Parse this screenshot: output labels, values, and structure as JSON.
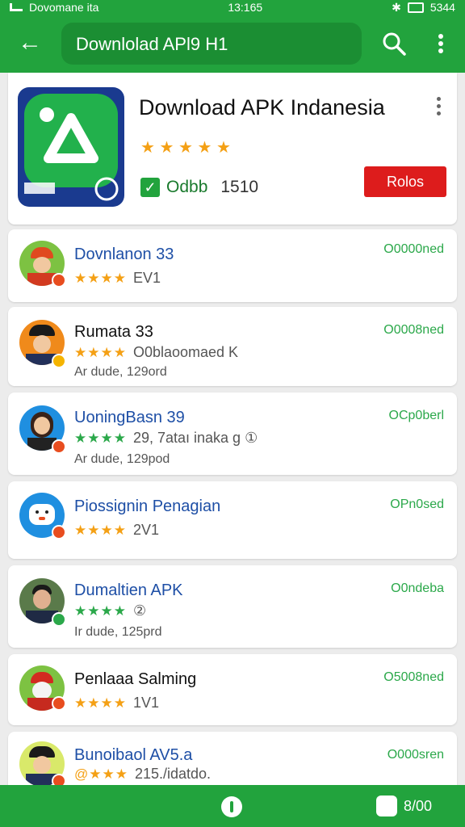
{
  "status_bar": {
    "left": "Dovomane ita",
    "time": "13:165",
    "right": "5344"
  },
  "search": {
    "value": "Downlolad APl9 H1"
  },
  "header": {
    "title": "Download APK  Indanesia",
    "rating_text": "★ ★ ★ ★ ★",
    "verified_text": "Odbb",
    "count_text": "1510",
    "action_label": "Rolos"
  },
  "items": [
    {
      "name": "Dovnlanon 33",
      "stars": "★★★★",
      "count": "EV1",
      "subtitle": "",
      "status": "O0000ned",
      "name_color": "#1e4fa6",
      "star_color": "#f4a015"
    },
    {
      "name": "Rumata 33",
      "stars": "★★★★",
      "count": "O0blaoomaed K",
      "subtitle": "Ar dude, 129ord",
      "status": "O0008ned",
      "name_color": "#111111",
      "star_color": "#f4a015"
    },
    {
      "name": "UoningBasn 39",
      "stars": "★★★★",
      "count": "29, 7ataı inaka g ①",
      "subtitle": "Ar dude, 129pod",
      "status": "OCp0berl",
      "name_color": "#1e4fa6",
      "star_color": "#2ba84a"
    },
    {
      "name": "Piossignin Penagian",
      "stars": "★★★★",
      "count": "2V1",
      "subtitle": "",
      "status": "OPn0sed",
      "name_color": "#1e4fa6",
      "star_color": "#f4a015"
    },
    {
      "name": "Dumaltien APK",
      "stars": "★★★★",
      "count": "②",
      "subtitle": "Ir dude, 125prd",
      "status": "O0ndeba",
      "name_color": "#1e4fa6",
      "star_color": "#2ba84a"
    },
    {
      "name": "Penlaaa Salming",
      "stars": "★★★★",
      "count": "1V1",
      "subtitle": "",
      "status": "O5008ned",
      "name_color": "#111111",
      "star_color": "#f4a015"
    },
    {
      "name": "Bunoibaol AV5.a",
      "stars": "@★★★",
      "count": "215./idatdo.",
      "subtitle": "",
      "status": "O000sren",
      "name_color": "#1e4fa6",
      "star_color": "#f4a015"
    }
  ],
  "bottom_bar": {
    "right_label": "8/00"
  }
}
